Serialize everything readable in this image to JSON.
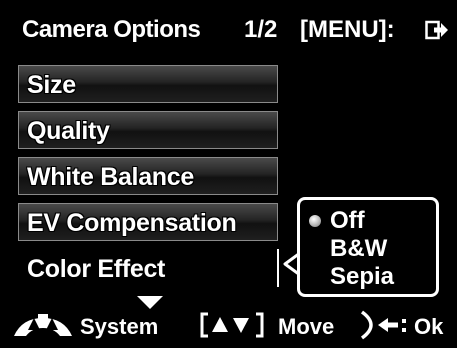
{
  "header": {
    "title": "Camera Options",
    "page_indicator": "1/2",
    "menu_hint": "[MENU]:",
    "exit_icon": "exit-arrow-icon"
  },
  "menu": {
    "items": [
      {
        "label": "Size"
      },
      {
        "label": "Quality"
      },
      {
        "label": "White Balance"
      },
      {
        "label": "EV Compensation"
      },
      {
        "label": "Color Effect"
      }
    ],
    "selected": "Color Effect"
  },
  "submenu": {
    "options": [
      {
        "label": "Off"
      },
      {
        "label": "B&W"
      },
      {
        "label": "Sepia"
      }
    ],
    "selected": "Off"
  },
  "footer": {
    "system_icon": "camera-mode-dial-icon",
    "system_label": "System",
    "updown_icon": "up-down-arrows-icon",
    "move_label": "Move",
    "ok_icon": "right-arrow-button-icon",
    "ok_label": "Ok"
  },
  "colors": {
    "background": "#000000",
    "text": "#ffffff",
    "item_border": "#8a8a8a"
  }
}
